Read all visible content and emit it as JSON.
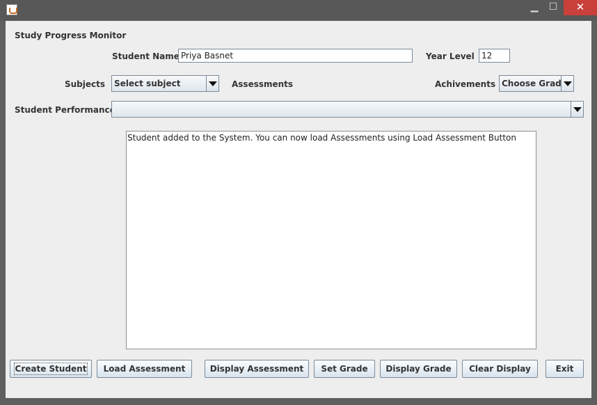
{
  "window": {
    "title_bar": {
      "app_icon": "java-icon",
      "minimize_glyph": "▁",
      "maximize_glyph": "☐",
      "close_glyph": "✕"
    }
  },
  "form": {
    "header": "Study Progress Monitor",
    "student_name_label": "Student Name",
    "student_name_value": "Priya Basnet",
    "year_level_label": "Year Level",
    "year_level_value": "12",
    "subjects_label": "Subjects",
    "subjects_selected": "Select subject",
    "assessments_label": "Assessments",
    "achievements_label": "Achivements",
    "grade_selected": "Choose Grade",
    "performance_label": "Student Performance",
    "performance_selected": "",
    "display_text": "Student added to the System. You can now load Assessments using Load Assessment Button"
  },
  "buttons": {
    "create_student": "Create Student",
    "load_assessment": "Load Assessment",
    "display_assessment": "Display Assessment",
    "set_grade": "Set Grade",
    "display_grade": "Display Grade",
    "clear_display": "Clear Display",
    "exit": "Exit"
  }
}
